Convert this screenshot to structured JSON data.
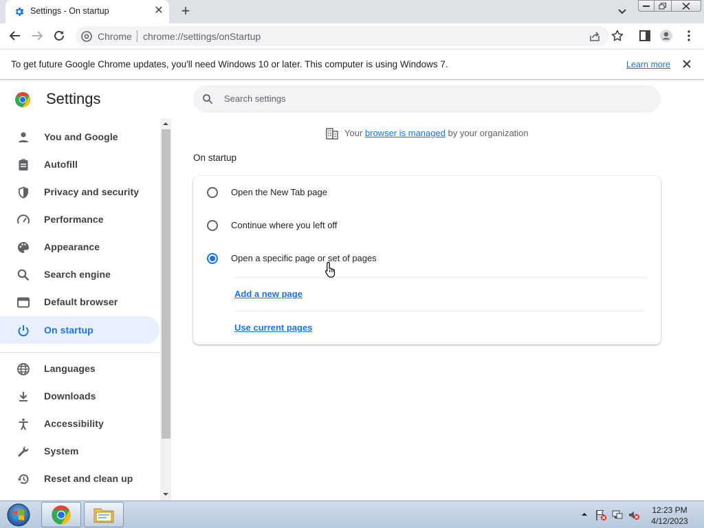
{
  "browser": {
    "tab_title": "Settings - On startup",
    "site_label": "Chrome",
    "url": "chrome://settings/onStartup"
  },
  "infobar": {
    "message": "To get future Google Chrome updates, you'll need Windows 10 or later. This computer is using Windows 7.",
    "learn_more": "Learn more"
  },
  "settings": {
    "title": "Settings",
    "search_placeholder": "Search settings",
    "managed_prefix": "Your ",
    "managed_link": "browser is managed",
    "managed_suffix": " by your organization",
    "nav": [
      {
        "label": "You and Google",
        "icon": "person-icon"
      },
      {
        "label": "Autofill",
        "icon": "clipboard-icon"
      },
      {
        "label": "Privacy and security",
        "icon": "shield-icon"
      },
      {
        "label": "Performance",
        "icon": "speedometer-icon"
      },
      {
        "label": "Appearance",
        "icon": "palette-icon"
      },
      {
        "label": "Search engine",
        "icon": "search-icon"
      },
      {
        "label": "Default browser",
        "icon": "browser-window-icon"
      },
      {
        "label": "On startup",
        "icon": "power-icon",
        "active": true
      },
      {
        "label": "Languages",
        "icon": "globe-icon"
      },
      {
        "label": "Downloads",
        "icon": "download-icon"
      },
      {
        "label": "Accessibility",
        "icon": "accessibility-icon"
      },
      {
        "label": "System",
        "icon": "wrench-icon"
      },
      {
        "label": "Reset and clean up",
        "icon": "reset-history-icon"
      }
    ],
    "section_title": "On startup",
    "options": [
      {
        "label": "Open the New Tab page",
        "checked": false
      },
      {
        "label": "Continue where you left off",
        "checked": false
      },
      {
        "label": "Open a specific page or set of pages",
        "checked": true
      }
    ],
    "add_page": "Add a new page",
    "use_current": "Use current pages"
  },
  "taskbar": {
    "time": "12:23 PM",
    "date": "4/12/2023"
  },
  "colors": {
    "accent": "#1a73e8",
    "active_nav_bg": "#e8f0fe"
  }
}
